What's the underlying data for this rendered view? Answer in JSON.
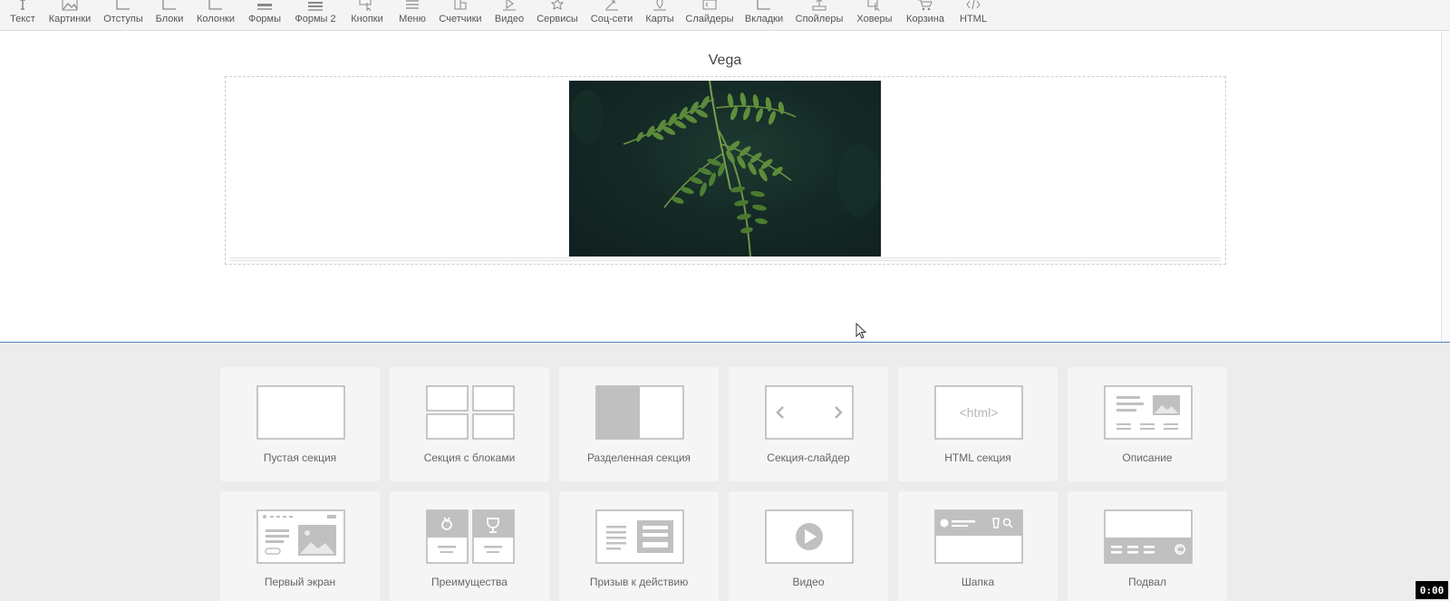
{
  "toolbar": {
    "items": [
      "Текст",
      "Картинки",
      "Отступы",
      "Блоки",
      "Колонки",
      "Формы",
      "Формы 2",
      "Кнопки",
      "Меню",
      "Счетчики",
      "Видео",
      "Сервисы",
      "Соц-сети",
      "Карты",
      "Слайдеры",
      "Вкладки",
      "Спойлеры",
      "Ховеры",
      "Корзина",
      "HTML"
    ]
  },
  "canvas": {
    "section_title": "Vega"
  },
  "presets": [
    {
      "label": "Пустая секция",
      "icon": "empty-section-icon"
    },
    {
      "label": "Секция с блоками",
      "icon": "blocks-section-icon"
    },
    {
      "label": "Разделенная секция",
      "icon": "split-section-icon"
    },
    {
      "label": "Секция-слайдер",
      "icon": "slider-section-icon"
    },
    {
      "label": "HTML секция",
      "icon": "html-section-icon",
      "html_text": "<html>"
    },
    {
      "label": "Описание",
      "icon": "description-icon"
    },
    {
      "label": "Первый экран",
      "icon": "first-screen-icon"
    },
    {
      "label": "Преимущества",
      "icon": "advantages-icon"
    },
    {
      "label": "Призыв к действию",
      "icon": "call-to-action-icon"
    },
    {
      "label": "Видео",
      "icon": "video-icon"
    },
    {
      "label": "Шапка",
      "icon": "header-icon"
    },
    {
      "label": "Подвал",
      "icon": "footer-icon"
    }
  ],
  "timer": "0:00",
  "colors": {
    "accent": "#4f86c6",
    "icon_stroke": "#b5b5b5",
    "icon_fill": "#bdbdbd"
  }
}
